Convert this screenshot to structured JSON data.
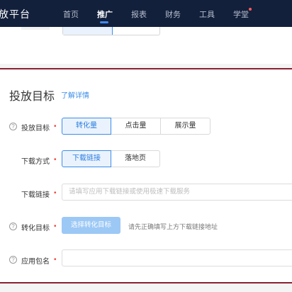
{
  "app": {
    "brand": "投放平台",
    "brand_visible": "放平台"
  },
  "nav": {
    "items": [
      {
        "label": "首页"
      },
      {
        "label": "推广"
      },
      {
        "label": "报表"
      },
      {
        "label": "财务"
      },
      {
        "label": "工具"
      },
      {
        "label": "学堂"
      }
    ],
    "active_index": 1
  },
  "section": {
    "title": "投放目标",
    "detail_link": "了解详情"
  },
  "form": {
    "goal": {
      "label": "投放目标",
      "options": [
        "转化量",
        "点击量",
        "展示量"
      ],
      "selected": "转化量"
    },
    "download_method": {
      "label": "下载方式",
      "options": [
        "下载链接",
        "落地页"
      ],
      "selected": "下载链接"
    },
    "download_link": {
      "label": "下载链接",
      "value": "",
      "placeholder": "请填写应用下载链接或使用极速下载服务"
    },
    "conversion_goal": {
      "label": "转化目标",
      "button": "选择转化目标",
      "hint": "请先正确填写上方下载链接地址"
    },
    "package_name": {
      "label": "应用包名",
      "value": ""
    }
  },
  "colors": {
    "nav_bg": "#13203c",
    "accent": "#3c8de8",
    "required": "#f0443c",
    "card_border": "#8a2230",
    "disabled_button": "#9cc8f5"
  },
  "icons": {
    "help": "question-circle-icon",
    "notification": "red-dot-badge"
  }
}
